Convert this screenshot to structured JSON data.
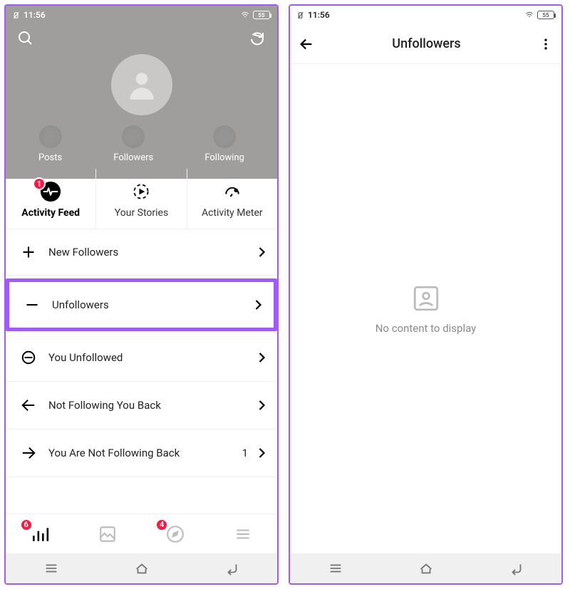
{
  "statusbar": {
    "time": "11:56",
    "battery": "55"
  },
  "hero": {
    "stats": [
      {
        "label": "Posts"
      },
      {
        "label": "Followers"
      },
      {
        "label": "Following"
      }
    ]
  },
  "tabs": [
    {
      "label": "Activity Feed",
      "badge": "1",
      "active": true
    },
    {
      "label": "Your Stories"
    },
    {
      "label": "Activity Meter"
    }
  ],
  "rows": [
    {
      "icon": "plus",
      "label": "New Followers"
    },
    {
      "icon": "minus",
      "label": "Unfollowers",
      "highlight": true
    },
    {
      "icon": "circle-minus",
      "label": "You Unfollowed"
    },
    {
      "icon": "arrow-left",
      "label": "Not Following You Back"
    },
    {
      "icon": "arrow-right",
      "label": "You Are Not Following Back",
      "count": "1"
    }
  ],
  "bottomnav": {
    "badges": {
      "stats": "6",
      "explore": "4"
    }
  },
  "right": {
    "title": "Unfollowers",
    "empty": "No content to display"
  }
}
